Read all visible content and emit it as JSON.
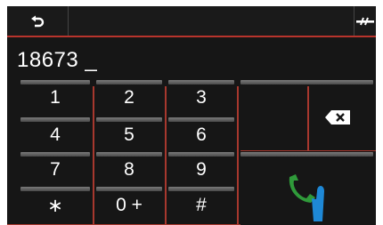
{
  "topbar": {
    "back_icon": "back-arrow-icon",
    "end_icon": "hang-up-icon"
  },
  "dial": {
    "number": "18673",
    "cursor": "_"
  },
  "keys": {
    "k1": "1",
    "k2": "2",
    "k3": "3",
    "k4": "4",
    "k5": "5",
    "k6": "6",
    "k7": "7",
    "k8": "8",
    "k9": "9",
    "kstar": "∗",
    "k0": "0 +",
    "khash": "#"
  },
  "actions": {
    "backspace_icon": "backspace-icon",
    "call_icon": "phone-call-icon"
  },
  "colors": {
    "accent": "#b8342c",
    "background": "#161616",
    "call_green": "#2f9a3a",
    "pointer_blue": "#1e88d6"
  }
}
